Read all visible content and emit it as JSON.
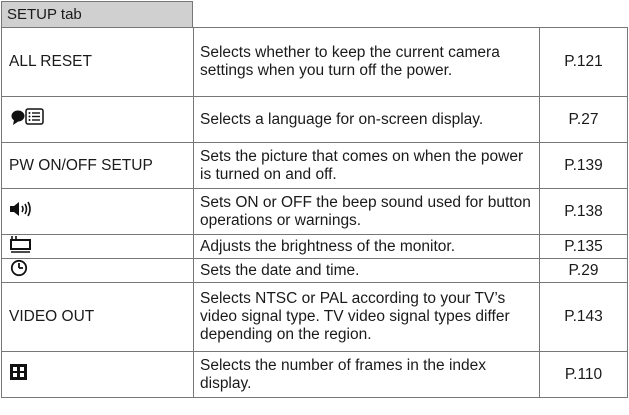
{
  "tab_title": "SETUP tab",
  "rows": [
    {
      "name": "ALL RESET",
      "icon": null,
      "description": "Selects whether to keep the current camera settings when you turn off the power.",
      "page": "P.121"
    },
    {
      "name": "",
      "icon": "language-icon",
      "description": "Selects a language for on-screen display.",
      "page": "P.27"
    },
    {
      "name": "PW ON/OFF SETUP",
      "icon": null,
      "description": "Sets the picture that comes on when the power is turned on and off.",
      "page": "P.139"
    },
    {
      "name": "",
      "icon": "beep-sound-icon",
      "description": "Sets ON or OFF the beep sound used for button operations or warnings.",
      "page": "P.138"
    },
    {
      "name": "",
      "icon": "monitor-brightness-icon",
      "description": "Adjusts the brightness of the monitor.",
      "page": "P.135"
    },
    {
      "name": "",
      "icon": "clock-icon",
      "description": "Sets the date and time.",
      "page": "P.29"
    },
    {
      "name": "VIDEO OUT",
      "icon": null,
      "description": "Selects NTSC or PAL according to your TV’s video signal type. TV video signal types differ depending on the region.",
      "page": "P.143"
    },
    {
      "name": "",
      "icon": "index-frames-icon",
      "description": "Selects the number of frames in the index display.",
      "page": "P.110"
    }
  ]
}
